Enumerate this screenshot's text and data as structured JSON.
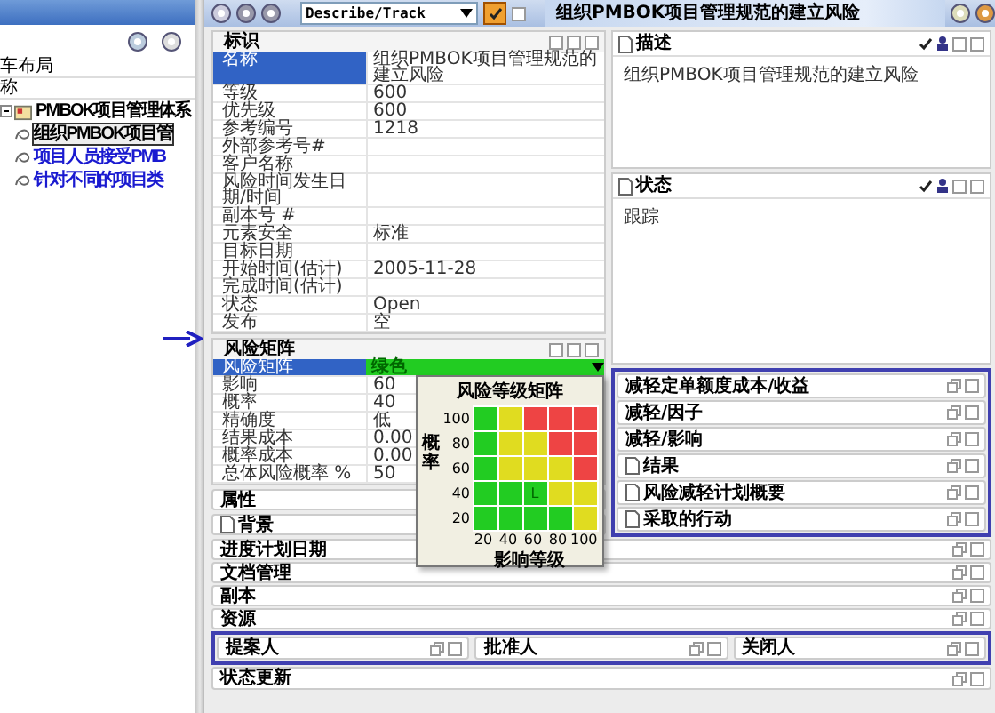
{
  "tree_panel": {
    "rows": [
      "车布局",
      "称"
    ],
    "tree": [
      {
        "label": "PMBOK项目管理体系",
        "expanded": true,
        "selected": false,
        "children": [
          {
            "label": "组织PMBOK项目管",
            "selected": true
          },
          {
            "label": "项目人员接受PMB",
            "selected": false
          },
          {
            "label": "针对不同的项目类",
            "selected": false
          }
        ]
      }
    ]
  },
  "toolbar": {
    "view_select": {
      "value": "Describe/Track"
    },
    "title": "组织PMBOK项目管理规范的建立风险"
  },
  "identity": {
    "title": "标识",
    "rows": [
      {
        "label": "名称",
        "value": "组织PMBOK项目管理规范的建立风险",
        "selected": true
      },
      {
        "label": "等级",
        "value": "600",
        "selected": false
      },
      {
        "label": "优先级",
        "value": "600",
        "selected": false
      },
      {
        "label": "参考编号",
        "value": "1218",
        "selected": false
      },
      {
        "label": "外部参考号#",
        "selected": false
      },
      {
        "label": "客户名称",
        "selected": false
      },
      {
        "label": "风险时间发生日期/时间",
        "selected": false
      },
      {
        "label": "副本号 #",
        "selected": false
      },
      {
        "label": "元素安全",
        "value": "标准",
        "selected": false
      },
      {
        "label": "目标日期",
        "selected": false
      },
      {
        "label": "开始时间(估计)",
        "value": "2005-11-28",
        "selected": false
      },
      {
        "label": "完成时间(估计)",
        "selected": false
      },
      {
        "label": "状态",
        "value": "Open",
        "selected": false
      },
      {
        "label": "发布",
        "value": "空",
        "selected": false
      }
    ]
  },
  "risk_matrix": {
    "title": "风险矩阵",
    "rows": [
      {
        "label": "风险矩阵",
        "value": "绿色",
        "selected": true,
        "kind": "dropdown",
        "color": "#22cc22"
      },
      {
        "label": "影响",
        "value": "60",
        "selected": false,
        "kind": "text"
      },
      {
        "label": "概率",
        "value": "40",
        "selected": false,
        "kind": "text"
      },
      {
        "label": "精确度",
        "value": "低",
        "selected": false,
        "kind": "text"
      },
      {
        "label": "结果成本",
        "value": "0.00",
        "selected": false,
        "kind": "text"
      },
      {
        "label": "概率成本",
        "value": "0.00",
        "selected": false,
        "kind": "text"
      },
      {
        "label": "总体风险概率 %",
        "value": "50",
        "selected": false,
        "kind": "text"
      }
    ],
    "popup": {
      "title": "风险等级矩阵",
      "y_label": "概率",
      "x_label": "影响等级",
      "y_ticks": [
        "100",
        "80",
        "60",
        "40",
        "20"
      ],
      "x_ticks": [
        "20",
        "40",
        "60",
        "80",
        "100"
      ],
      "cells": [
        [
          {
            "color": "#22cc22"
          },
          {
            "color": "#e0dc20"
          },
          {
            "color": "#ee4444"
          },
          {
            "color": "#ee4444"
          },
          {
            "color": "#ee4444"
          }
        ],
        [
          {
            "color": "#22cc22"
          },
          {
            "color": "#e0dc20"
          },
          {
            "color": "#e0dc20"
          },
          {
            "color": "#ee4444"
          },
          {
            "color": "#ee4444"
          }
        ],
        [
          {
            "color": "#22cc22"
          },
          {
            "color": "#e0dc20"
          },
          {
            "color": "#e0dc20"
          },
          {
            "color": "#e0dc20"
          },
          {
            "color": "#ee4444"
          }
        ],
        [
          {
            "color": "#22cc22"
          },
          {
            "color": "#22cc22"
          },
          {
            "color": "#22cc22",
            "label": "L"
          },
          {
            "color": "#e0dc20"
          },
          {
            "color": "#e0dc20"
          }
        ],
        [
          {
            "color": "#22cc22"
          },
          {
            "color": "#22cc22"
          },
          {
            "color": "#22cc22"
          },
          {
            "color": "#22cc22"
          },
          {
            "color": "#e0dc20"
          }
        ]
      ]
    }
  },
  "left_collapsed": [
    {
      "title": "属性",
      "kind": "plain"
    },
    {
      "title": "背景",
      "kind": "note"
    }
  ],
  "right_panels": [
    {
      "title": "描述",
      "text": "组织PMBOK项目管理规范的建立风险"
    },
    {
      "title": "状态",
      "text": "跟踪"
    }
  ],
  "mitigation_group": [
    {
      "title": "减轻定单额度成本/收益",
      "kind": "plain"
    },
    {
      "title": "减轻/因子",
      "kind": "plain"
    },
    {
      "title": "减轻/影响",
      "kind": "plain"
    },
    {
      "title": "结果",
      "kind": "note"
    },
    {
      "title": "风险减轻计划概要",
      "kind": "note"
    },
    {
      "title": "采取的行动",
      "kind": "note"
    }
  ],
  "full_rows": [
    {
      "title": "进度计划日期"
    },
    {
      "title": "文档管理"
    },
    {
      "title": "副本"
    },
    {
      "title": "资源"
    }
  ],
  "people_row": [
    {
      "title": "提案人"
    },
    {
      "title": "批准人"
    },
    {
      "title": "关闭人"
    }
  ],
  "last_row": {
    "title": "状态更新"
  }
}
